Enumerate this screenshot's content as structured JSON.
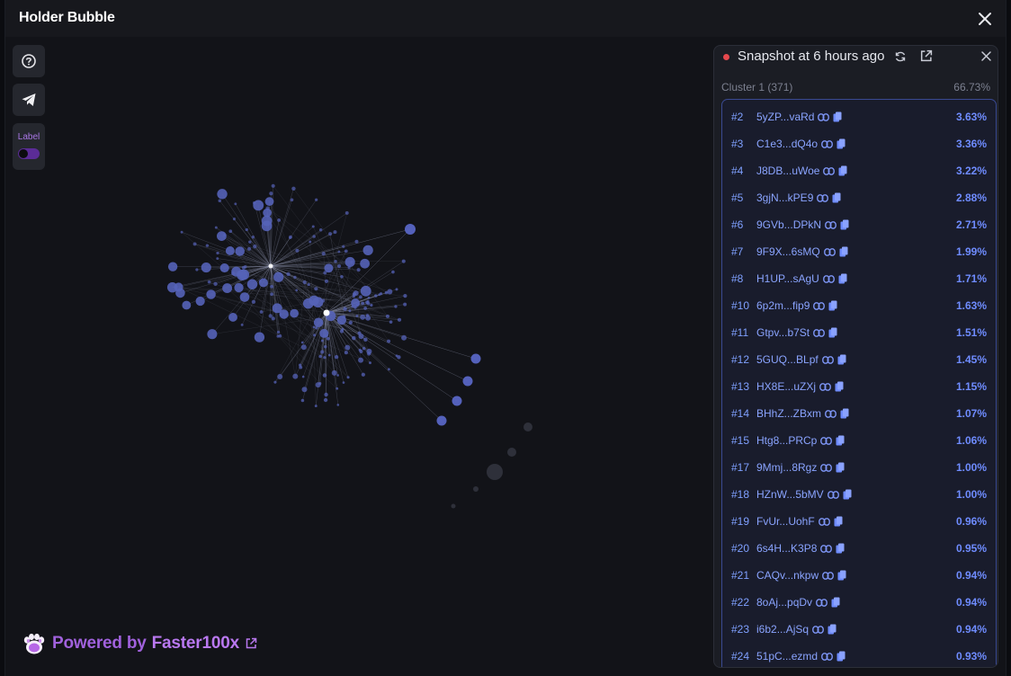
{
  "window": {
    "title": "Holder Bubble"
  },
  "toolbar": {
    "label_toggle": "Label"
  },
  "footer": {
    "powered_prefix": "Powered by",
    "brand": "Faster100x"
  },
  "snapshot": {
    "title": "Snapshot at 6 hours ago"
  },
  "cluster": {
    "name": "Cluster 1 (371)",
    "percent": "66.73%"
  },
  "holders": [
    {
      "rank": "#2",
      "address": "5yZP...vaRd",
      "percent": "3.63%"
    },
    {
      "rank": "#3",
      "address": "C1e3...dQ4o",
      "percent": "3.36%"
    },
    {
      "rank": "#4",
      "address": "J8DB...uWoe",
      "percent": "3.22%"
    },
    {
      "rank": "#5",
      "address": "3gjN...kPE9",
      "percent": "2.88%"
    },
    {
      "rank": "#6",
      "address": "9GVb...DPkN",
      "percent": "2.71%"
    },
    {
      "rank": "#7",
      "address": "9F9X...6sMQ",
      "percent": "1.99%"
    },
    {
      "rank": "#8",
      "address": "H1UP...sAgU",
      "percent": "1.71%"
    },
    {
      "rank": "#10",
      "address": "6p2m...fip9",
      "percent": "1.63%"
    },
    {
      "rank": "#11",
      "address": "Gtpv...b7St",
      "percent": "1.51%"
    },
    {
      "rank": "#12",
      "address": "5GUQ...BLpf",
      "percent": "1.45%"
    },
    {
      "rank": "#13",
      "address": "HX8E...uZXj",
      "percent": "1.15%"
    },
    {
      "rank": "#14",
      "address": "BHhZ...ZBxm",
      "percent": "1.07%"
    },
    {
      "rank": "#15",
      "address": "Htg8...PRCp",
      "percent": "1.06%"
    },
    {
      "rank": "#17",
      "address": "9Mmj...8Rgz",
      "percent": "1.00%"
    },
    {
      "rank": "#18",
      "address": "HZnW...5bMV",
      "percent": "1.00%"
    },
    {
      "rank": "#19",
      "address": "FvUr...UohF",
      "percent": "0.96%"
    },
    {
      "rank": "#20",
      "address": "6s4H...K3P8",
      "percent": "0.95%"
    },
    {
      "rank": "#21",
      "address": "CAQv...nkpw",
      "percent": "0.94%"
    },
    {
      "rank": "#22",
      "address": "8oAj...pqDv",
      "percent": "0.94%"
    },
    {
      "rank": "#23",
      "address": "i6b2...AjSq",
      "percent": "0.94%"
    },
    {
      "rank": "#24",
      "address": "51pC...ezmd",
      "percent": "0.93%"
    }
  ],
  "colors": {
    "accent": "#6f8cff",
    "brand": "#a061dc",
    "live": "#e5484d"
  },
  "icons": [
    "close-icon",
    "help-icon",
    "telegram-icon",
    "refresh-icon",
    "external-link-icon",
    "link-icon",
    "copy-icon",
    "paw-logo-icon"
  ]
}
